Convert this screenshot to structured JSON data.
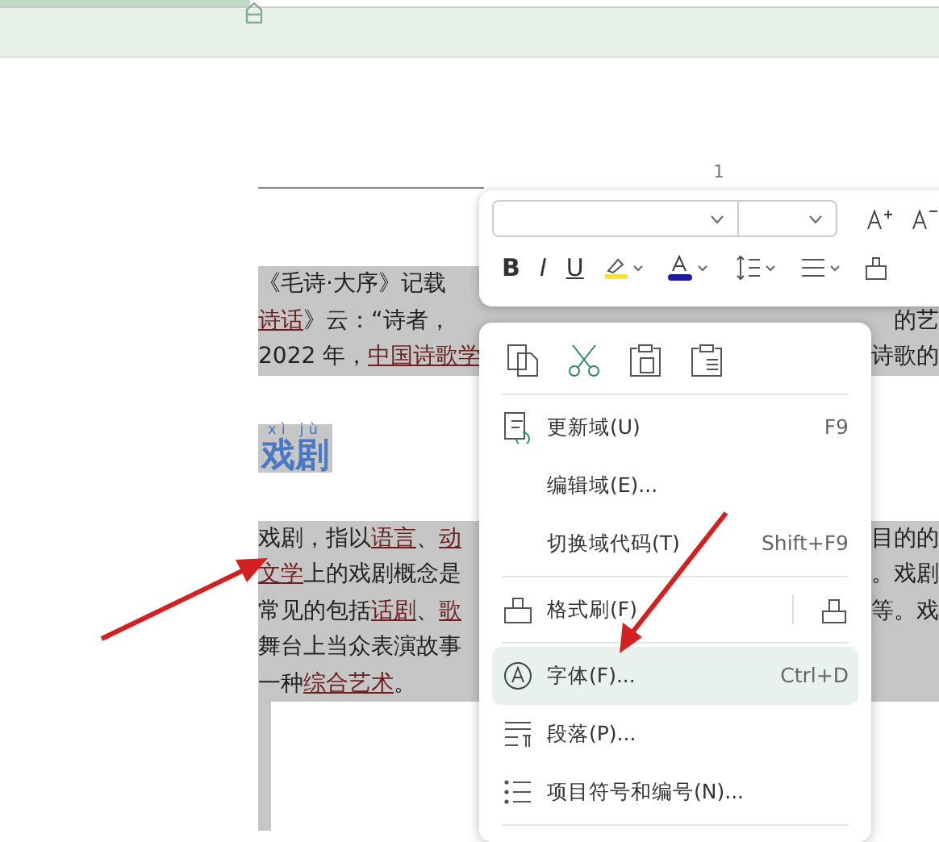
{
  "page_number": "1",
  "document": {
    "lines": [
      {
        "left": [
          {
            "text": "《毛诗·大序》记载",
            "link": false
          }
        ]
      },
      {
        "left": [
          {
            "text": "诗话",
            "link": true
          },
          {
            "text": "》云：“诗者，",
            "link": false
          }
        ],
        "right": [
          {
            "text": "的艺",
            "link": false
          }
        ]
      },
      {
        "left": [
          {
            "text": "2022 年，",
            "link": false
          },
          {
            "text": "中国诗歌学",
            "link": true
          }
        ],
        "right": [
          {
            "text": "诗歌的",
            "link": false
          }
        ]
      }
    ],
    "heading": {
      "text": "戏剧",
      "ruby": "xì jù"
    },
    "paragraph": [
      {
        "left": [
          {
            "text": "戏剧，指以",
            "link": false
          },
          {
            "text": "语言",
            "link": true
          },
          {
            "text": "、",
            "link": false
          },
          {
            "text": "动",
            "link": true
          }
        ],
        "right": [
          {
            "text": "目的的",
            "link": false
          }
        ]
      },
      {
        "left": [
          {
            "text": "文学",
            "link": true
          },
          {
            "text": "上的戏剧概念是",
            "link": false
          }
        ],
        "right": [
          {
            "text": "。戏剧",
            "link": false
          }
        ]
      },
      {
        "left": [
          {
            "text": "常见的包括",
            "link": false
          },
          {
            "text": "话剧",
            "link": true
          },
          {
            "text": "、",
            "link": false
          },
          {
            "text": "歌",
            "link": true
          }
        ],
        "right": [
          {
            "text": "等。戏",
            "link": false
          }
        ]
      },
      {
        "left": [
          {
            "text": "舞台上当众表演故事",
            "link": false
          }
        ]
      },
      {
        "left": [
          {
            "text": "一种",
            "link": false
          },
          {
            "text": "综合艺术",
            "link": true
          },
          {
            "text": "。",
            "link": false
          }
        ]
      }
    ]
  },
  "mini_toolbar": {
    "format_buttons": [
      "B",
      "I",
      "U"
    ]
  },
  "context_menu": {
    "items": [
      {
        "kind": "icons"
      },
      {
        "kind": "divider"
      },
      {
        "kind": "item",
        "label": "更新域(U)",
        "shortcut": "F9",
        "selected": false
      },
      {
        "kind": "item",
        "label": "编辑域(E)...",
        "selected": false
      },
      {
        "kind": "item",
        "label": "切换域代码(T)",
        "shortcut": "Shift+F9",
        "selected": false
      },
      {
        "kind": "divider"
      },
      {
        "kind": "item",
        "label": "格式刷(F)",
        "selected": false,
        "side_button": true
      },
      {
        "kind": "divider"
      },
      {
        "kind": "item",
        "label": "字体(F)...",
        "shortcut": "Ctrl+D",
        "selected": true
      },
      {
        "kind": "item",
        "label": "段落(P)...",
        "selected": false
      },
      {
        "kind": "item",
        "label": "项目符号和编号(N)...",
        "selected": false
      },
      {
        "kind": "divider"
      }
    ]
  }
}
